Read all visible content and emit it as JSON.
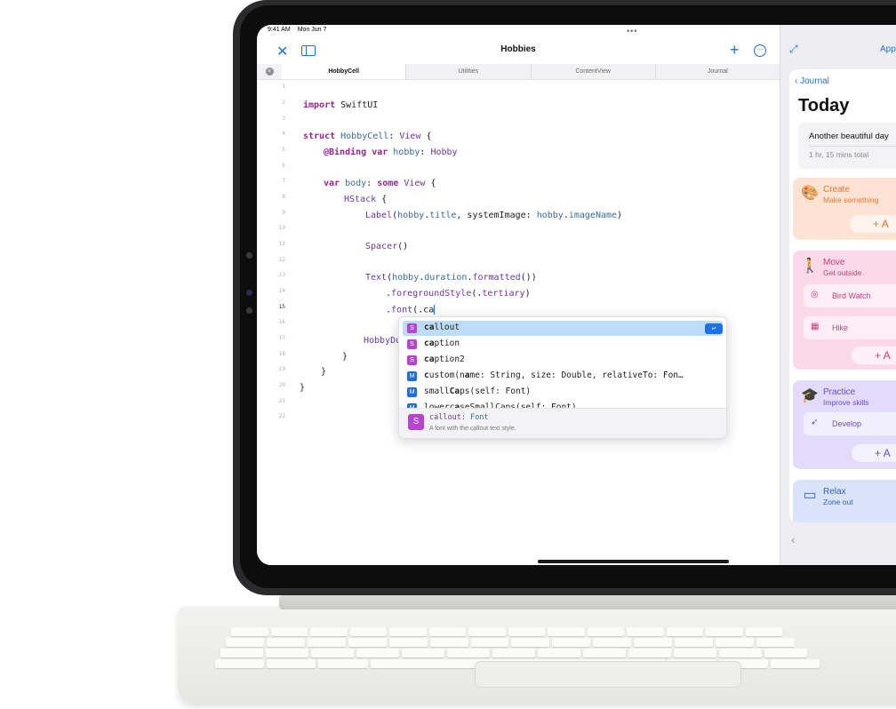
{
  "status_bar": {
    "time": "9:41 AM",
    "date": "Mon Jun 7"
  },
  "window": {
    "title": "Hobbies"
  },
  "tabs": [
    "HobbyCell",
    "Utilities",
    "ContentView",
    "Journal"
  ],
  "line_numbers": [
    "1",
    "2",
    "3",
    "4",
    "5",
    "6",
    "7",
    "8",
    "9",
    "10",
    "11",
    "12",
    "13",
    "14",
    "15",
    "16",
    "17",
    "18",
    "19",
    "20",
    "21",
    "22"
  ],
  "code": {
    "l2_kw": "import",
    "l2_rest": " SwiftUI",
    "l4_kw": "struct",
    "l4_name": " HobbyCell",
    "l4_colon": ": ",
    "l4_type": "View",
    "l4_brace": " {",
    "l5_attr": "@Binding",
    "l5_var": " var",
    "l5_name": " hobby",
    "l5_colon": ": ",
    "l5_type": "Hobby",
    "l7_var": "var",
    "l7_name": " body",
    "l7_colon": ": ",
    "l7_some": "some",
    "l7_type": " View",
    "l7_brace": " {",
    "l8_type": "HStack",
    "l8_brace": " {",
    "l9_type": "Label",
    "l9_p1": "(",
    "l9_a": "hobby",
    "l9_dot": ".",
    "l9_b": "title",
    "l9_p2": ", systemImage: ",
    "l9_c": "hobby",
    "l9_dot2": ".",
    "l9_d": "imageName",
    "l9_p3": ")",
    "l11_type": "Spacer",
    "l11_p": "()",
    "l13_type": "Text",
    "l13_p1": "(",
    "l13_a": "hobby",
    "l13_dot": ".",
    "l13_b": "duration",
    "l13_dot2": ".",
    "l13_c": "formatted",
    "l13_p2": "())",
    "l14_dot": ".",
    "l14_fn": "foregroundStyle",
    "l14_p1": "(.",
    "l14_arg": "tertiary",
    "l14_p2": ")",
    "l15_dot": ".",
    "l15_fn": "font",
    "l15_p1": "(.",
    "l15_typed": "ca",
    "l17_text": "HobbyDu",
    "l18_text": "}",
    "l19_text": "}",
    "l20_text": "}"
  },
  "autocomplete": {
    "items": [
      {
        "badge": "S",
        "bold": "ca",
        "rest": "llout"
      },
      {
        "badge": "S",
        "bold": "ca",
        "rest": "ption"
      },
      {
        "badge": "S",
        "bold": "ca",
        "rest": "ption2"
      },
      {
        "badge": "M",
        "pre": "",
        "bold": "c",
        "rest": "ustom(n",
        "bold2": "a",
        "rest2": "me: String, size: Double, relativeTo: Fon…"
      },
      {
        "badge": "M",
        "pre": "small",
        "bold": "Ca",
        "rest": "ps(self: Font)"
      },
      {
        "badge": "M",
        "pre": "lowerc",
        "bold": "a",
        "rest": "seSmallCaps(self: Font)"
      }
    ],
    "return_icon": "↩",
    "footer": {
      "badge": "S",
      "name": "callout",
      "sep": ": ",
      "type": "Font",
      "desc": "A font with the callout text style."
    }
  },
  "side_app": {
    "top_link": "App",
    "back_label": "Journal",
    "heading": "Today",
    "summary_title": "Another beautiful day",
    "summary_duration": "1 hr, 15 mins total",
    "categories": [
      {
        "title": "Create",
        "subtitle": "Make something",
        "color": "#e8762c",
        "bg": "#fde3d3"
      },
      {
        "title": "Move",
        "subtitle": "Get outside",
        "color": "#d13a7a",
        "bg": "#fbd9e8",
        "items": [
          "Bird Watch",
          "Hike"
        ]
      },
      {
        "title": "Practice",
        "subtitle": "Improve skills",
        "color": "#6b4bd6",
        "bg": "#e2dcfa",
        "items": [
          "Develop"
        ]
      },
      {
        "title": "Relax",
        "subtitle": "Zone out",
        "color": "#2f62c9",
        "bg": "#d9e4fa"
      }
    ],
    "add_label": "+",
    "add_text": "A"
  },
  "icons": {
    "close": "close-icon",
    "sidebar": "sidebar-toggle-icon",
    "plus": "plus-icon",
    "more": "more-icon",
    "expand": "expand-icon",
    "back": "chevron-left-icon"
  }
}
